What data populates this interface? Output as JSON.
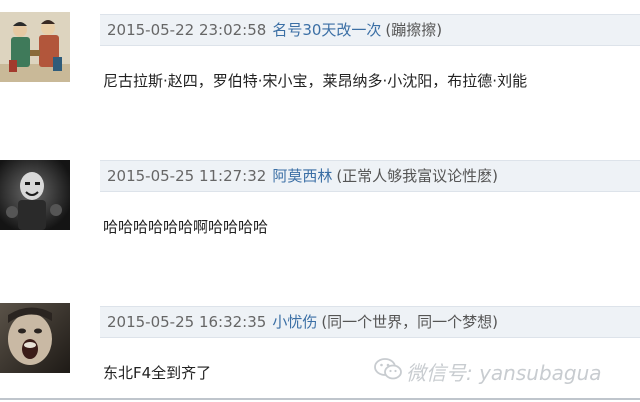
{
  "comments": [
    {
      "timestamp": "2015-05-22 23:02:58",
      "username": "名号30天改一次",
      "signature": "(蹦擦擦)",
      "text": "尼古拉斯·赵四，罗伯特·宋小宝，莱昂纳多·小沈阳，布拉德·刘能",
      "avatar": "painting-two-figures-avatar"
    },
    {
      "timestamp": "2015-05-25 11:27:32",
      "username": "阿莫西林",
      "signature": "(正常人够我富议论性麽)",
      "text": "哈哈哈哈哈哈啊哈哈哈哈",
      "avatar": "masked-figure-avatar"
    },
    {
      "timestamp": "2015-05-25 16:32:35",
      "username": "小忧伤",
      "signature": "(同一个世界，同一个梦想)",
      "text": "东北F4全到齐了",
      "avatar": "screaming-face-avatar"
    }
  ],
  "watermark": {
    "icon": "wechat-icon",
    "text": "微信号: yansubagua"
  },
  "colors": {
    "meta_bar_bg": "#eef2f6",
    "username_link": "#3b6fa5",
    "watermark": "#c8ccd0"
  }
}
